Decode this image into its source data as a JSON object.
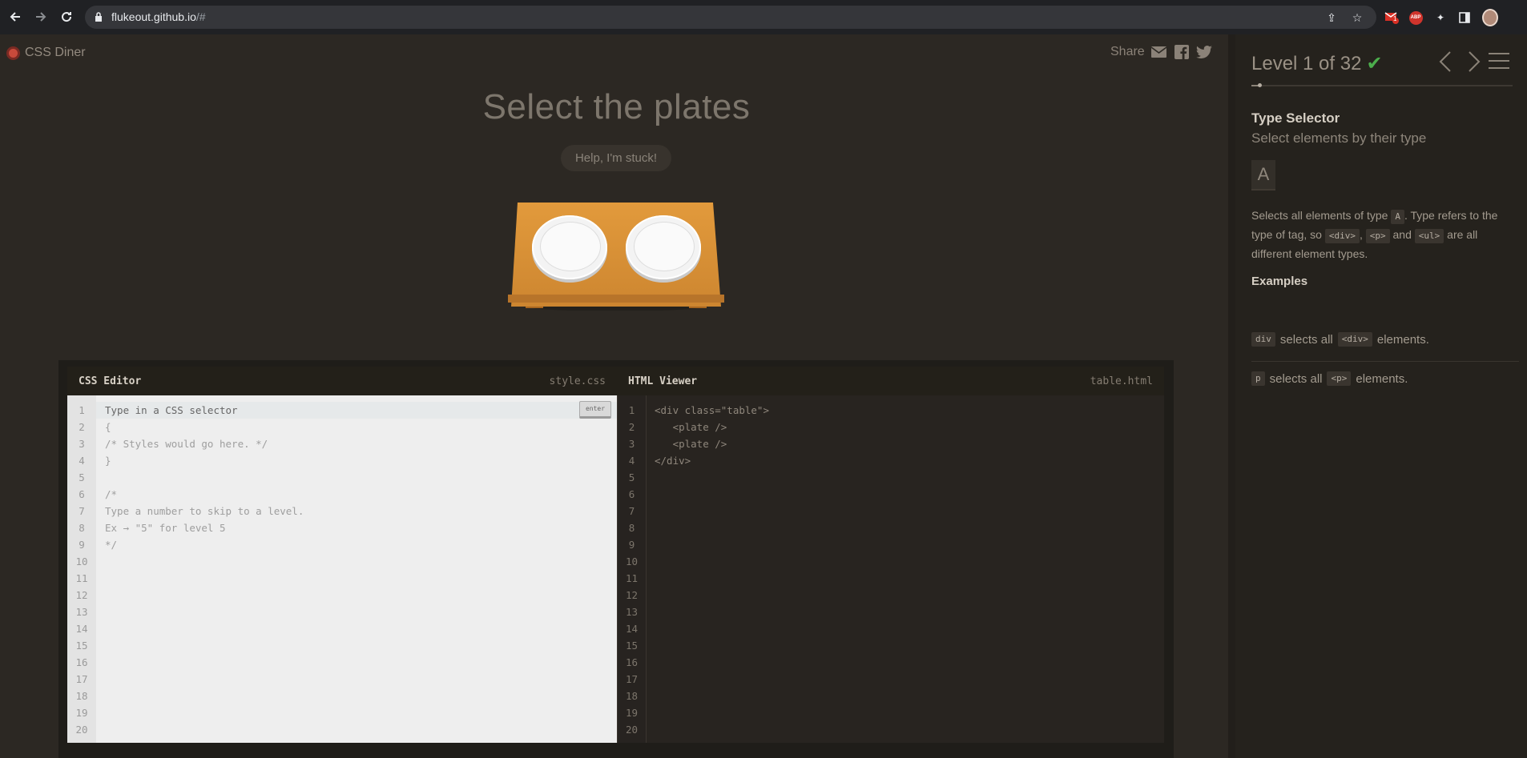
{
  "browser": {
    "url_main": "flukeout.github.io",
    "url_rest": "/#",
    "notification_count": "1"
  },
  "header": {
    "brand": "CSS Diner",
    "share_label": "Share"
  },
  "main": {
    "title": "Select the plates",
    "help_button": "Help, I'm stuck!"
  },
  "css_editor": {
    "title": "CSS Editor",
    "filename": "style.css",
    "enter_label": "enter",
    "line_numbers": [
      "1",
      "2",
      "3",
      "4",
      "5",
      "6",
      "7",
      "8",
      "9",
      "10",
      "11",
      "12",
      "13",
      "14",
      "15",
      "16",
      "17",
      "18",
      "19",
      "20"
    ],
    "lines": [
      "Type in a CSS selector",
      "{",
      "/* Styles would go here. */",
      "}",
      "",
      "/*",
      "Type a number to skip to a level.",
      "Ex → \"5\" for level 5",
      "*/"
    ]
  },
  "html_viewer": {
    "title": "HTML Viewer",
    "filename": "table.html",
    "line_numbers": [
      "1",
      "2",
      "3",
      "4",
      "5",
      "6",
      "7",
      "8",
      "9",
      "10",
      "11",
      "12",
      "13",
      "14",
      "15",
      "16",
      "17",
      "18",
      "19",
      "20"
    ],
    "lines": [
      "<div class=\"table\">",
      "   <plate />",
      "   <plate />",
      "</div>"
    ]
  },
  "sidebar": {
    "level_label": "Level 1 of 32",
    "progress": 0.03125,
    "selector_name": "Type Selector",
    "selector_desc": "Select elements by their type",
    "syntax": "A",
    "para_1": "Selects all elements of type",
    "para_tag_a": "A",
    "para_2": ". Type refers to the type of tag, so",
    "para_tag_div": "<div>",
    "para_3": ",",
    "para_tag_p": "<p>",
    "para_4": "and",
    "para_tag_ul": "<ul>",
    "para_5": "are all different element types.",
    "examples_head": "Examples",
    "example_1": {
      "code": "div",
      "mid": "selects all",
      "tag": "<div>",
      "end": "elements."
    },
    "example_2": {
      "code": "p",
      "mid": "selects all",
      "tag": "<p>",
      "end": "elements."
    }
  },
  "colors": {
    "background": "#2c2823",
    "table": "#d88f34",
    "check": "#4cae4c",
    "brand_dot": "#c94a3b"
  }
}
